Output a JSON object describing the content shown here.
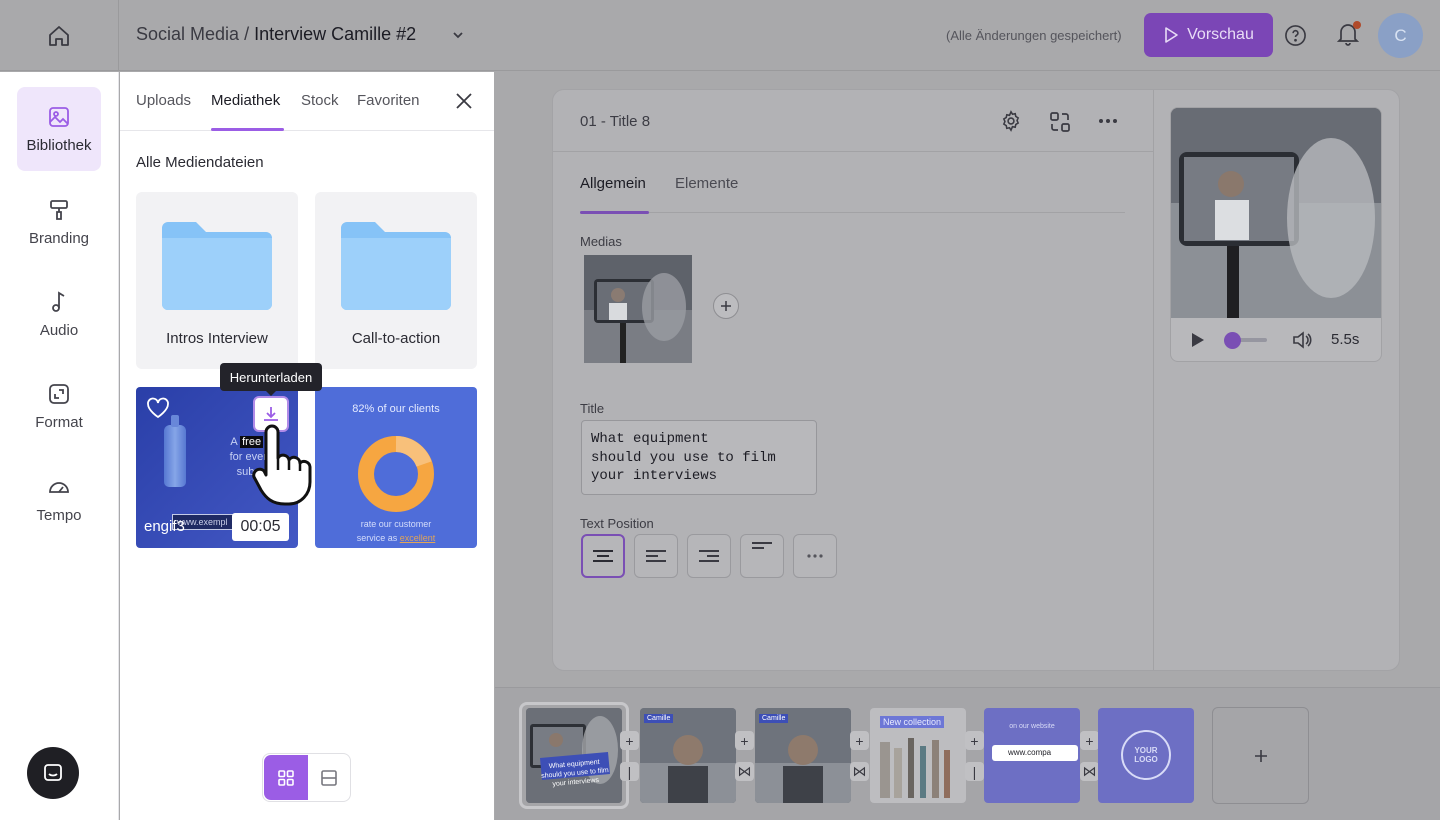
{
  "header": {
    "breadcrumb_folder": "Social Media",
    "breadcrumb_separator": "/",
    "project_name": "Interview Camille #2",
    "save_status": "(Alle Änderungen gespeichert)",
    "preview_label": "Vorschau",
    "avatar_initial": "C"
  },
  "sidebar": {
    "items": [
      {
        "label": "Bibliothek",
        "icon": "image-icon",
        "active": true
      },
      {
        "label": "Branding",
        "icon": "paint-roller-icon"
      },
      {
        "label": "Audio",
        "icon": "music-note-icon"
      },
      {
        "label": "Format",
        "icon": "format-icon"
      },
      {
        "label": "Tempo",
        "icon": "speedometer-icon"
      }
    ]
  },
  "library": {
    "tabs": [
      "Uploads",
      "Mediathek",
      "Stock",
      "Favoriten"
    ],
    "active_tab": "Mediathek",
    "section_title": "Alle Mediendateien",
    "folders": [
      {
        "name": "Intros Interview"
      },
      {
        "name": "Call-to-action"
      }
    ],
    "media": [
      {
        "name": "engif3",
        "duration": "00:05",
        "overlay_text_a": "A",
        "overlay_free": "free",
        "overlay_text_b": "k",
        "overlay_line2": "for every",
        "overlay_line3": "subsc",
        "url_text": "www.exempl"
      },
      {
        "headline": "82% of our clients",
        "footer_line1": "rate our customer",
        "footer_line2": "service as",
        "footer_highlight": "excellent"
      }
    ],
    "tooltip": "Herunterladen"
  },
  "editor": {
    "slide_title": "01 - Title 8",
    "tabs": [
      "Allgemein",
      "Elemente"
    ],
    "active_tab": "Allgemein",
    "medias_label": "Medias",
    "title_label": "Title",
    "title_value": "What equipment\nshould you use to film\nyour interviews",
    "text_position_label": "Text Position",
    "text_position_options": [
      "center",
      "left",
      "right",
      "top-left",
      "more"
    ],
    "text_position_selected": "center"
  },
  "preview_player": {
    "time": "5.5s",
    "progress": 0.1
  },
  "timeline": {
    "clips": [
      {
        "caption": "What equipment should you use to film your interviews"
      },
      {
        "caption": "Camille"
      },
      {
        "caption": "Camille"
      },
      {
        "caption": "New collection"
      },
      {
        "caption_top": "on our website",
        "url": "www.compa"
      },
      {
        "logo_line1": "YOUR",
        "logo_line2": "LOGO"
      }
    ]
  },
  "colors": {
    "accent": "#9b5de5",
    "accent_dimmed": "#7b46b6",
    "overlay_gray": "#a9a9ab",
    "donut_orange": "#f6a641"
  }
}
